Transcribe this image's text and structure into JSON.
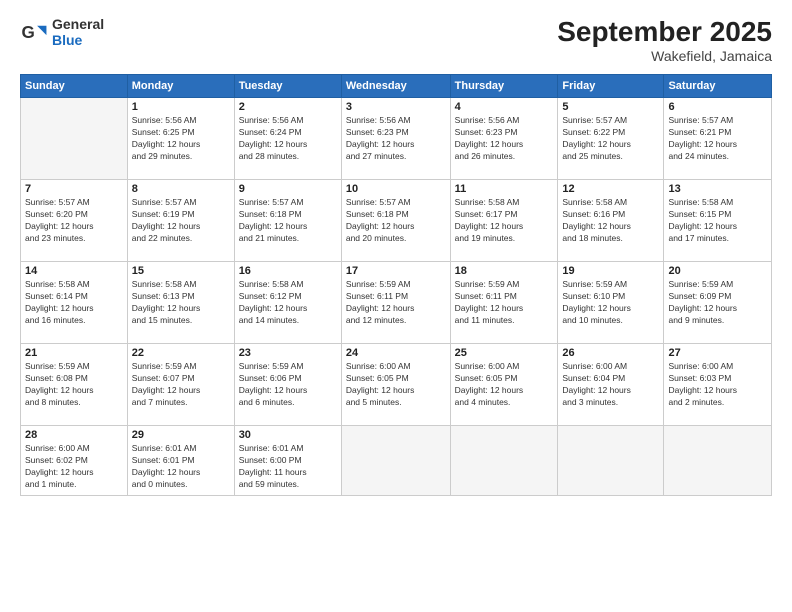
{
  "header": {
    "logo_general": "General",
    "logo_blue": "Blue",
    "month_title": "September 2025",
    "subtitle": "Wakefield, Jamaica"
  },
  "weekdays": [
    "Sunday",
    "Monday",
    "Tuesday",
    "Wednesday",
    "Thursday",
    "Friday",
    "Saturday"
  ],
  "weeks": [
    [
      {
        "day": "",
        "info": ""
      },
      {
        "day": "1",
        "info": "Sunrise: 5:56 AM\nSunset: 6:25 PM\nDaylight: 12 hours\nand 29 minutes."
      },
      {
        "day": "2",
        "info": "Sunrise: 5:56 AM\nSunset: 6:24 PM\nDaylight: 12 hours\nand 28 minutes."
      },
      {
        "day": "3",
        "info": "Sunrise: 5:56 AM\nSunset: 6:23 PM\nDaylight: 12 hours\nand 27 minutes."
      },
      {
        "day": "4",
        "info": "Sunrise: 5:56 AM\nSunset: 6:23 PM\nDaylight: 12 hours\nand 26 minutes."
      },
      {
        "day": "5",
        "info": "Sunrise: 5:57 AM\nSunset: 6:22 PM\nDaylight: 12 hours\nand 25 minutes."
      },
      {
        "day": "6",
        "info": "Sunrise: 5:57 AM\nSunset: 6:21 PM\nDaylight: 12 hours\nand 24 minutes."
      }
    ],
    [
      {
        "day": "7",
        "info": "Sunrise: 5:57 AM\nSunset: 6:20 PM\nDaylight: 12 hours\nand 23 minutes."
      },
      {
        "day": "8",
        "info": "Sunrise: 5:57 AM\nSunset: 6:19 PM\nDaylight: 12 hours\nand 22 minutes."
      },
      {
        "day": "9",
        "info": "Sunrise: 5:57 AM\nSunset: 6:18 PM\nDaylight: 12 hours\nand 21 minutes."
      },
      {
        "day": "10",
        "info": "Sunrise: 5:57 AM\nSunset: 6:18 PM\nDaylight: 12 hours\nand 20 minutes."
      },
      {
        "day": "11",
        "info": "Sunrise: 5:58 AM\nSunset: 6:17 PM\nDaylight: 12 hours\nand 19 minutes."
      },
      {
        "day": "12",
        "info": "Sunrise: 5:58 AM\nSunset: 6:16 PM\nDaylight: 12 hours\nand 18 minutes."
      },
      {
        "day": "13",
        "info": "Sunrise: 5:58 AM\nSunset: 6:15 PM\nDaylight: 12 hours\nand 17 minutes."
      }
    ],
    [
      {
        "day": "14",
        "info": "Sunrise: 5:58 AM\nSunset: 6:14 PM\nDaylight: 12 hours\nand 16 minutes."
      },
      {
        "day": "15",
        "info": "Sunrise: 5:58 AM\nSunset: 6:13 PM\nDaylight: 12 hours\nand 15 minutes."
      },
      {
        "day": "16",
        "info": "Sunrise: 5:58 AM\nSunset: 6:12 PM\nDaylight: 12 hours\nand 14 minutes."
      },
      {
        "day": "17",
        "info": "Sunrise: 5:59 AM\nSunset: 6:11 PM\nDaylight: 12 hours\nand 12 minutes."
      },
      {
        "day": "18",
        "info": "Sunrise: 5:59 AM\nSunset: 6:11 PM\nDaylight: 12 hours\nand 11 minutes."
      },
      {
        "day": "19",
        "info": "Sunrise: 5:59 AM\nSunset: 6:10 PM\nDaylight: 12 hours\nand 10 minutes."
      },
      {
        "day": "20",
        "info": "Sunrise: 5:59 AM\nSunset: 6:09 PM\nDaylight: 12 hours\nand 9 minutes."
      }
    ],
    [
      {
        "day": "21",
        "info": "Sunrise: 5:59 AM\nSunset: 6:08 PM\nDaylight: 12 hours\nand 8 minutes."
      },
      {
        "day": "22",
        "info": "Sunrise: 5:59 AM\nSunset: 6:07 PM\nDaylight: 12 hours\nand 7 minutes."
      },
      {
        "day": "23",
        "info": "Sunrise: 5:59 AM\nSunset: 6:06 PM\nDaylight: 12 hours\nand 6 minutes."
      },
      {
        "day": "24",
        "info": "Sunrise: 6:00 AM\nSunset: 6:05 PM\nDaylight: 12 hours\nand 5 minutes."
      },
      {
        "day": "25",
        "info": "Sunrise: 6:00 AM\nSunset: 6:05 PM\nDaylight: 12 hours\nand 4 minutes."
      },
      {
        "day": "26",
        "info": "Sunrise: 6:00 AM\nSunset: 6:04 PM\nDaylight: 12 hours\nand 3 minutes."
      },
      {
        "day": "27",
        "info": "Sunrise: 6:00 AM\nSunset: 6:03 PM\nDaylight: 12 hours\nand 2 minutes."
      }
    ],
    [
      {
        "day": "28",
        "info": "Sunrise: 6:00 AM\nSunset: 6:02 PM\nDaylight: 12 hours\nand 1 minute."
      },
      {
        "day": "29",
        "info": "Sunrise: 6:01 AM\nSunset: 6:01 PM\nDaylight: 12 hours\nand 0 minutes."
      },
      {
        "day": "30",
        "info": "Sunrise: 6:01 AM\nSunset: 6:00 PM\nDaylight: 11 hours\nand 59 minutes."
      },
      {
        "day": "",
        "info": ""
      },
      {
        "day": "",
        "info": ""
      },
      {
        "day": "",
        "info": ""
      },
      {
        "day": "",
        "info": ""
      }
    ]
  ]
}
